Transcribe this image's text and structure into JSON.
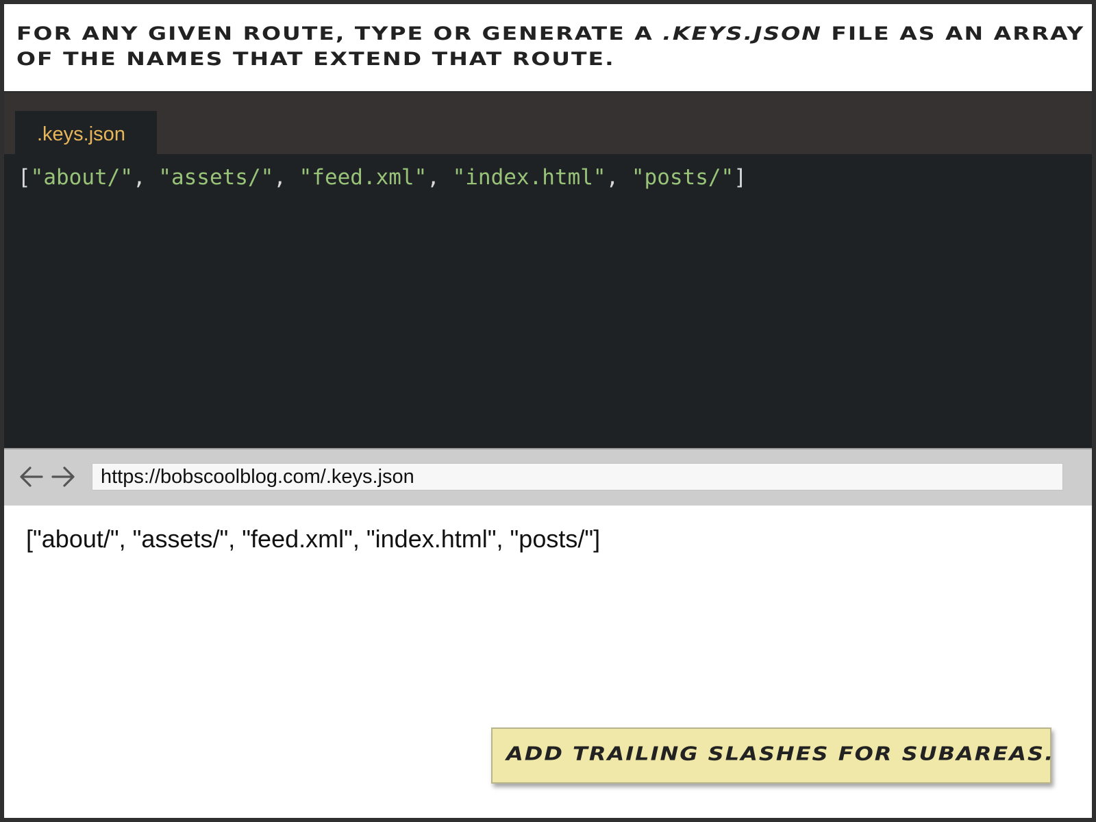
{
  "caption": {
    "part1": "For any given route, type or generate a ",
    "emphasis": ".keys.json",
    "part2": " file as an array of the names that extend that route."
  },
  "editor": {
    "tab_label": ".keys.json",
    "code": {
      "open": "[",
      "sep": ", ",
      "close": "]",
      "items": [
        "\"about/\"",
        "\"assets/\"",
        "\"feed.xml\"",
        "\"index.html\"",
        "\"posts/\""
      ]
    }
  },
  "browser": {
    "back_icon": "arrow-left-icon",
    "forward_icon": "arrow-right-icon",
    "url": "https://bobscoolblog.com/.keys.json",
    "content": "[\"about/\", \"assets/\", \"feed.xml\", \"index.html\", \"posts/\"]"
  },
  "note": {
    "text": "Add trailing slashes for subareas."
  },
  "colors": {
    "editor_bg": "#1e2224",
    "tabbar_bg": "#373232",
    "tab_label": "#e8b65a",
    "string": "#98c379",
    "note_bg": "#efe8a9"
  }
}
